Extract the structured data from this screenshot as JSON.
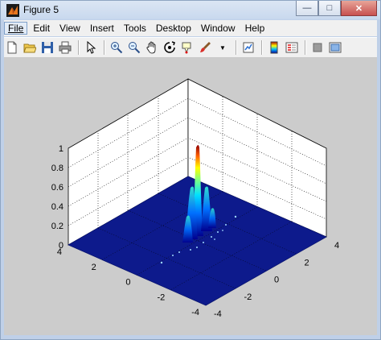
{
  "window": {
    "title": "Figure 5"
  },
  "menu": [
    "File",
    "Edit",
    "View",
    "Insert",
    "Tools",
    "Desktop",
    "Window",
    "Help"
  ],
  "toolbar": [
    "new-figure-icon",
    "open-file-icon",
    "save-icon",
    "print-icon",
    "edit-plot-arrow-icon",
    "zoom-in-icon",
    "zoom-out-icon",
    "pan-hand-icon",
    "rotate-3d-icon",
    "data-cursor-icon",
    "brush-icon",
    "link-plot-icon",
    "colorbar-icon",
    "legend-icon",
    "hide-plot-tools-icon",
    "show-plot-tools-icon"
  ],
  "colors": {
    "floor": "#0d1a8c",
    "canvas": "#cccccc"
  },
  "plot": {
    "type": "surface",
    "zticks": [
      "0",
      "0.2",
      "0.4",
      "0.6",
      "0.8",
      "1"
    ],
    "xticks": [
      "4",
      "2",
      "0",
      "-2",
      "-4"
    ],
    "yticks": [
      "4",
      "2",
      "0",
      "-2",
      "-4"
    ]
  }
}
